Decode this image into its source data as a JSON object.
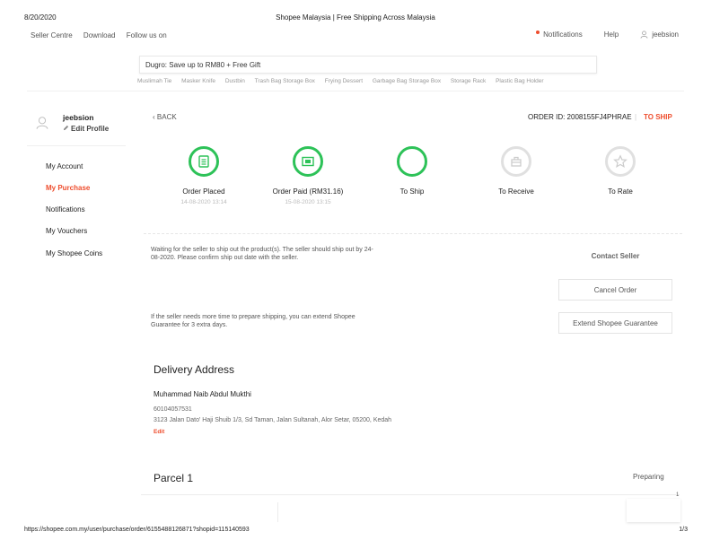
{
  "print_header": {
    "date": "8/20/2020",
    "title": "Shopee Malaysia | Free Shipping Across Malaysia"
  },
  "top_nav": {
    "left": [
      "Seller Centre",
      "Download",
      "Follow us on"
    ],
    "notifications": "Notifications",
    "help": "Help",
    "user": "jeebsion"
  },
  "search": {
    "text": "Dugro: Save up to RM80 + Free Gift",
    "suggestions": [
      "Muslimah Tie",
      "Masker Knife",
      "Dustbin",
      "Trash Bag Storage Box",
      "Frying Dessert",
      "Garbage Bag Storage Box",
      "Storage Rack",
      "Plastic Bag Holder"
    ]
  },
  "sidebar": {
    "username": "jeebsion",
    "edit_profile": "Edit Profile",
    "items": [
      "My Account",
      "My Purchase",
      "Notifications",
      "My Vouchers",
      "My Shopee Coins"
    ]
  },
  "order": {
    "back": "BACK",
    "order_id": "ORDER ID: 2008155FJ4PHRAE",
    "separator": "|",
    "status": "TO SHIP"
  },
  "steps": [
    {
      "label": "Order Placed",
      "time": "14-08-2020 13:14",
      "icon": "receipt-icon",
      "done": true
    },
    {
      "label": "Order Paid (RM31.16)",
      "time": "15-08-2020 13:15",
      "icon": "payment-icon",
      "done": true
    },
    {
      "label": "To Ship",
      "time": "",
      "icon": "ship-circle-icon",
      "done": true
    },
    {
      "label": "To Receive",
      "time": "",
      "icon": "package-icon",
      "done": false
    },
    {
      "label": "To Rate",
      "time": "",
      "icon": "star-icon",
      "done": false
    }
  ],
  "notices": {
    "wait_text": "Waiting for the seller to ship out the product(s). The seller should ship out by 24-08-2020. Please confirm ship out date with the seller.",
    "extend_text": "If the seller needs more time to prepare shipping, you can extend Shopee Guarantee for 3 extra days.",
    "contact_seller": "Contact Seller",
    "cancel_order": "Cancel Order",
    "extend_guarantee": "Extend Shopee Guarantee"
  },
  "delivery": {
    "title": "Delivery Address",
    "name": "Muhammad Naib Abdul Mukthi",
    "phone": "60104057531",
    "address": "3123 Jalan Dato' Haji Shuib 1/3, Sd Taman, Jalan Sultanah, Alor Setar, 05200, Kedah",
    "edit": "Edit"
  },
  "parcel": {
    "title": "Parcel 1",
    "status": "Preparing",
    "count": "1"
  },
  "footer": {
    "url": "https://shopee.com.my/user/purchase/order/6155488126871?shopid=115140593",
    "page": "1/3"
  },
  "colors": {
    "accent": "#ee4d2d",
    "success": "#2dc258",
    "inactive": "#e0e0e0"
  }
}
